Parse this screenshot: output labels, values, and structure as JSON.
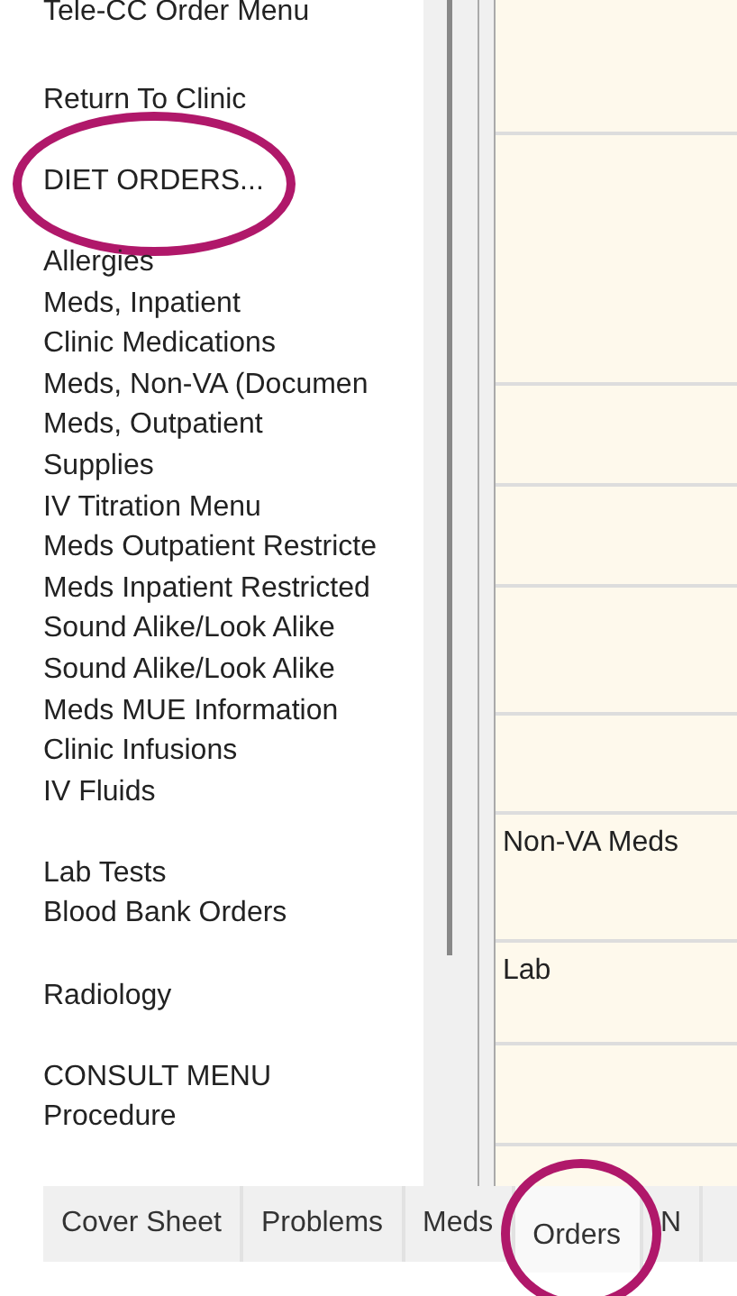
{
  "menu_items": [
    {
      "label": "Tele-CC Order Menu",
      "blank_before": false,
      "circled": false
    },
    {
      "label": "Return To Clinic",
      "blank_before": true,
      "circled": false
    },
    {
      "label": "DIET ORDERS...",
      "blank_before": true,
      "circled": true
    },
    {
      "label": "Allergies",
      "blank_before": true,
      "circled": false
    },
    {
      "label": "Meds, Inpatient",
      "blank_before": false,
      "circled": false
    },
    {
      "label": "Clinic Medications",
      "blank_before": false,
      "circled": false
    },
    {
      "label": "Meds, Non-VA (Documen",
      "blank_before": false,
      "circled": false
    },
    {
      "label": "Meds, Outpatient",
      "blank_before": false,
      "circled": false
    },
    {
      "label": "Supplies",
      "blank_before": false,
      "circled": false
    },
    {
      "label": "IV Titration Menu",
      "blank_before": false,
      "circled": false
    },
    {
      "label": "Meds Outpatient Restricte",
      "blank_before": false,
      "circled": false
    },
    {
      "label": "Meds Inpatient Restricted",
      "blank_before": false,
      "circled": false
    },
    {
      "label": "Sound Alike/Look Alike",
      "blank_before": false,
      "circled": false
    },
    {
      "label": "Sound Alike/Look Alike",
      "blank_before": false,
      "circled": false
    },
    {
      "label": "Meds MUE Information",
      "blank_before": false,
      "circled": false
    },
    {
      "label": "Clinic Infusions",
      "blank_before": false,
      "circled": false
    },
    {
      "label": "IV Fluids",
      "blank_before": false,
      "circled": false
    },
    {
      "label": "Lab Tests",
      "blank_before": true,
      "circled": false
    },
    {
      "label": "Blood Bank Orders",
      "blank_before": false,
      "circled": false
    },
    {
      "label": "Radiology",
      "blank_before": true,
      "circled": false
    },
    {
      "label": "CONSULT MENU",
      "blank_before": true,
      "circled": false
    },
    {
      "label": "Procedure",
      "blank_before": false,
      "circled": false
    }
  ],
  "order_sections": [
    "Non-VA Meds",
    "Lab"
  ],
  "tabs": [
    {
      "label": "Cover Sheet",
      "selected": false,
      "circled": false
    },
    {
      "label": "Problems",
      "selected": false,
      "circled": false
    },
    {
      "label": "Meds",
      "selected": false,
      "circled": false
    },
    {
      "label": "Orders",
      "selected": true,
      "circled": true
    },
    {
      "label": "N",
      "selected": false,
      "circled": false
    }
  ]
}
